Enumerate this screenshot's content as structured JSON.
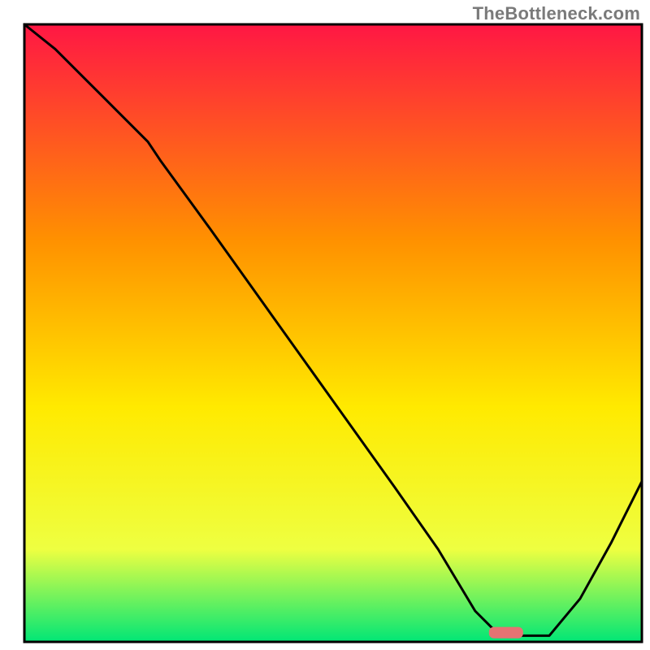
{
  "watermark": "TheBottleneck.com",
  "chart_data": {
    "type": "line",
    "title": "",
    "xlabel": "",
    "ylabel": "",
    "xlim": [
      0,
      100
    ],
    "ylim": [
      0,
      100
    ],
    "x": [
      0,
      5,
      10,
      15,
      20,
      22,
      30,
      40,
      50,
      60,
      67,
      70,
      73,
      76,
      80,
      85,
      90,
      95,
      100
    ],
    "values": [
      100,
      96,
      91,
      86,
      81,
      78,
      67,
      53,
      39,
      25,
      15,
      10,
      5,
      2,
      1,
      1,
      7,
      16,
      26
    ],
    "colors": {
      "top": "#ff1744",
      "upper_mid": "#ff9100",
      "mid": "#ffea00",
      "lower_mid": "#eeff41",
      "bottom": "#00e676"
    },
    "marker": {
      "x": 78,
      "y": 1.5,
      "color": "#e57373"
    },
    "curve_color": "#000000",
    "frame_color": "#000000"
  }
}
